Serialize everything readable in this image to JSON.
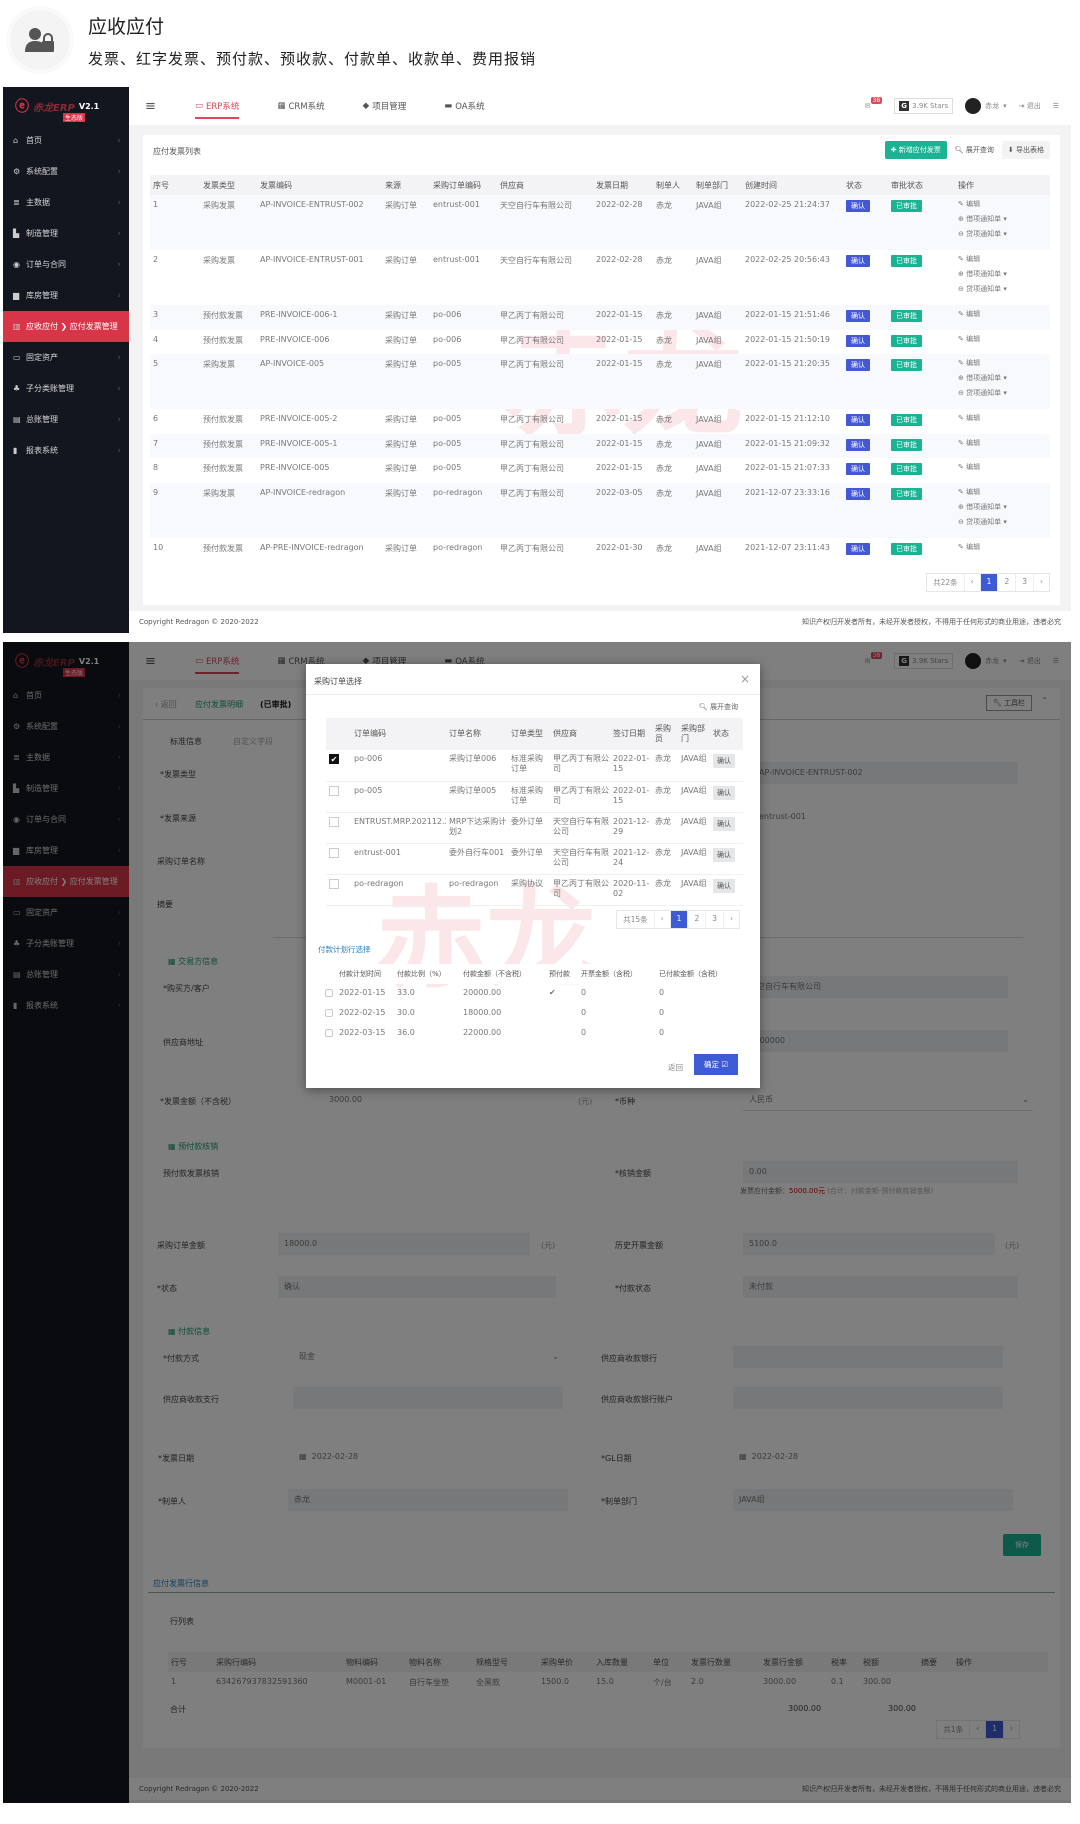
{
  "header": {
    "title": "应收应付",
    "subtitle": "发票、红字发票、预付款、预收款、付款单、收款单、费用报销",
    "icon": "user-lock-icon"
  },
  "app": {
    "logo": {
      "brand": "赤龙ERP",
      "version": "V2.1",
      "edition": "生态版"
    },
    "sidebar": [
      {
        "label": "首页",
        "icon": "home-icon"
      },
      {
        "label": "系统配置",
        "icon": "gear-icon"
      },
      {
        "label": "主数据",
        "icon": "database-icon"
      },
      {
        "label": "制造管理",
        "icon": "factory-icon"
      },
      {
        "label": "订单与合同",
        "icon": "eye-icon"
      },
      {
        "label": "库房管理",
        "icon": "warehouse-icon"
      },
      {
        "label": "应收应付 ❯ 应付发票管理",
        "icon": "bank-icon",
        "active": true
      },
      {
        "label": "固定资产",
        "icon": "monitor-icon"
      },
      {
        "label": "子分类账管理",
        "icon": "sitemap-icon"
      },
      {
        "label": "总账管理",
        "icon": "book-icon"
      },
      {
        "label": "报表系统",
        "icon": "chart-icon"
      }
    ],
    "tabs": [
      {
        "label": "ERP系统",
        "icon": "desktop-icon"
      },
      {
        "label": "CRM系统",
        "icon": "cards-icon"
      },
      {
        "label": "项目管理",
        "icon": "cube-icon"
      },
      {
        "label": "OA系统",
        "icon": "laptop-icon"
      }
    ],
    "topbar": {
      "badge": "38",
      "stars": "3.9K Stars",
      "user": "赤龙",
      "logout": "退出"
    },
    "footer": {
      "copyright": "Copyright Redragon © 2020-2022",
      "notice": "知识产权归开发者所有，未经开发者授权，不得用于任何形式的商业用途，违者必究"
    },
    "watermark": "赤龙"
  },
  "list": {
    "title": "应付发票列表",
    "add": "新增应付发票",
    "search": "展开查询",
    "export": "导出表格",
    "columns": [
      "序号",
      "发票类型",
      "发票编码",
      "来源",
      "采购订单编码",
      "供应商",
      "发票日期",
      "制单人",
      "制单部门",
      "创建时间",
      "状态",
      "审批状态",
      "操作"
    ],
    "rows": [
      {
        "c": [
          "1",
          "采购发票",
          "AP-INVOICE-ENTRUST-002",
          "采购订单",
          "entrust-001",
          "天空自行车有限公司",
          "2022-02-28",
          "赤龙",
          "JAVA组",
          "2022-02-25 21:24:37"
        ],
        "status": "确认",
        "approval": "已审批",
        "ops": [
          "编辑",
          "借项通知单",
          "贷项通知单"
        ]
      },
      {
        "c": [
          "2",
          "采购发票",
          "AP-INVOICE-ENTRUST-001",
          "采购订单",
          "entrust-001",
          "天空自行车有限公司",
          "2022-02-28",
          "赤龙",
          "JAVA组",
          "2022-02-25 20:56:43"
        ],
        "status": "确认",
        "approval": "已审批",
        "ops": [
          "编辑",
          "借项通知单",
          "贷项通知单"
        ]
      },
      {
        "c": [
          "3",
          "预付款发票",
          "PRE-INVOICE-006-1",
          "采购订单",
          "po-006",
          "甲乙丙丁有限公司",
          "2022-01-15",
          "赤龙",
          "JAVA组",
          "2022-01-15 21:51:46"
        ],
        "status": "确认",
        "approval": "已审批",
        "ops": [
          "编辑"
        ]
      },
      {
        "c": [
          "4",
          "预付款发票",
          "PRE-INVOICE-006",
          "采购订单",
          "po-006",
          "甲乙丙丁有限公司",
          "2022-01-15",
          "赤龙",
          "JAVA组",
          "2022-01-15 21:50:19"
        ],
        "status": "确认",
        "approval": "已审批",
        "ops": [
          "编辑"
        ]
      },
      {
        "c": [
          "5",
          "采购发票",
          "AP-INVOICE-005",
          "采购订单",
          "po-005",
          "甲乙丙丁有限公司",
          "2022-01-15",
          "赤龙",
          "JAVA组",
          "2022-01-15 21:20:35"
        ],
        "status": "确认",
        "approval": "已审批",
        "ops": [
          "编辑",
          "借项通知单",
          "贷项通知单"
        ]
      },
      {
        "c": [
          "6",
          "预付款发票",
          "PRE-INVOICE-005-2",
          "采购订单",
          "po-005",
          "甲乙丙丁有限公司",
          "2022-01-15",
          "赤龙",
          "JAVA组",
          "2022-01-15 21:12:10"
        ],
        "status": "确认",
        "approval": "已审批",
        "ops": [
          "编辑"
        ]
      },
      {
        "c": [
          "7",
          "预付款发票",
          "PRE-INVOICE-005-1",
          "采购订单",
          "po-005",
          "甲乙丙丁有限公司",
          "2022-01-15",
          "赤龙",
          "JAVA组",
          "2022-01-15 21:09:32"
        ],
        "status": "确认",
        "approval": "已审批",
        "ops": [
          "编辑"
        ]
      },
      {
        "c": [
          "8",
          "预付款发票",
          "PRE-INVOICE-005",
          "采购订单",
          "po-005",
          "甲乙丙丁有限公司",
          "2022-01-15",
          "赤龙",
          "JAVA组",
          "2022-01-15 21:07:33"
        ],
        "status": "确认",
        "approval": "已审批",
        "ops": [
          "编辑"
        ]
      },
      {
        "c": [
          "9",
          "采购发票",
          "AP-INVOICE-redragon",
          "采购订单",
          "po-redragon",
          "甲乙丙丁有限公司",
          "2022-03-05",
          "赤龙",
          "JAVA组",
          "2021-12-07 23:33:16"
        ],
        "status": "确认",
        "approval": "已审批",
        "ops": [
          "编辑",
          "借项通知单",
          "贷项通知单"
        ]
      },
      {
        "c": [
          "10",
          "预付款发票",
          "AP-PRE-INVOICE-redragon",
          "采购订单",
          "po-redragon",
          "甲乙丙丁有限公司",
          "2022-01-30",
          "赤龙",
          "JAVA组",
          "2021-12-07 23:11:43"
        ],
        "status": "确认",
        "approval": "已审批",
        "ops": [
          "编辑"
        ]
      }
    ],
    "pagination": {
      "total": "共22条",
      "prev": "‹",
      "pages": [
        "1",
        "2",
        "3"
      ],
      "next": "›"
    }
  },
  "detail": {
    "back": "‹ 返回",
    "title": "应付发票明细",
    "state": "(已审批)",
    "toolbar": "工具栏",
    "tabs": [
      "标准信息",
      "自定义字段"
    ],
    "left_labels": [
      {
        "l": "*发票类型"
      },
      {
        "l": "*发票来源"
      },
      {
        "l": "采购订单名称"
      },
      {
        "l": "摘要"
      }
    ],
    "right_values": [
      "AP-INVOICE-ENTRUST-002",
      "entrust-001"
    ],
    "sections": [
      "交易方信息",
      "预付款核销",
      "付款信息"
    ],
    "buyer_label": "*购买方/客户",
    "buyer_value": "天空自行车有限公司",
    "addr_label": "供应商地址",
    "addr_value": "V100000",
    "amount_label": "*发票金额（不含税）",
    "amount_value": "3000.00",
    "unit": "(元)",
    "currency_label": "*币种",
    "currency_value": "人民币",
    "prepay_label": "预付款发票核销",
    "writeoff_label": "*核销金额",
    "writeoff_value": "0.00",
    "hint_prefix": "发票应付金额：",
    "hint_amount": "5000.00元",
    "hint_suffix": "(合计：付款金额-预付款核销金额)",
    "po_amount_label": "采购订单金额",
    "po_amount_value": "18000.0",
    "hist_label": "历史开票金额",
    "hist_value": "5100.0",
    "status_label": "*状态",
    "status_value": "确认",
    "paystatus_label": "*付款状态",
    "paystatus_value": "未付款",
    "paymethod_label": "*付款方式",
    "paymethod_value": "现金",
    "bank_label": "供应商收款银行",
    "branch_label": "供应商收款支行",
    "account_label": "供应商收款银行账户",
    "invdate_label": "*发票日期",
    "invdate_value": "2022-02-28",
    "gldate_label": "*GL日期",
    "gldate_value": "2022-02-28",
    "creator_label": "*制单人",
    "creator_value": "赤龙",
    "dept_label": "*制单部门",
    "dept_value": "JAVA组",
    "save": "保存",
    "lines_link": "应付发票行信息",
    "lines_title": "行列表",
    "line_columns": [
      "行号",
      "采购行编码",
      "物料编码",
      "物料名称",
      "规格型号",
      "采购单价",
      "入库数量",
      "单位",
      "发票行数量",
      "发票行金额",
      "税率",
      "税额",
      "摘要",
      "操作"
    ],
    "line_rows": [
      [
        "1",
        "634267937832591360",
        "M0001-01",
        "自行车坐垫",
        "全黑款",
        "1500.0",
        "15.0",
        "个/台",
        "2.0",
        "3000.00",
        "0.1",
        "300.00",
        "",
        ""
      ]
    ],
    "total_label": "合计",
    "total_amount": "3000.00",
    "total_tax": "300.00",
    "pagination": {
      "total": "共1条",
      "prev": "‹",
      "pages": [
        "1"
      ],
      "next": "›"
    }
  },
  "modal": {
    "title": "采购订单选择",
    "close": "×",
    "search": "展开查询",
    "columns": [
      "",
      "订单编码",
      "订单名称",
      "订单类型",
      "供应商",
      "签订日期",
      "采购员",
      "采购部门",
      "状态"
    ],
    "rows": [
      {
        "checked": true,
        "c": [
          "po-006",
          "采购订单006",
          "标准采购订单",
          "甲乙丙丁有限公司",
          "2022-01-15",
          "赤龙",
          "JAVA组"
        ],
        "status": "确认"
      },
      {
        "checked": false,
        "c": [
          "po-005",
          "采购订单005",
          "标准采购订单",
          "甲乙丙丁有限公司",
          "2022-01-15",
          "赤龙",
          "JAVA组"
        ],
        "status": "确认"
      },
      {
        "checked": false,
        "c": [
          "ENTRUST.MRP.202112.2",
          "MRP下达采购计划2",
          "委外订单",
          "天空自行车有限公司",
          "2021-12-29",
          "赤龙",
          "JAVA组"
        ],
        "status": "确认"
      },
      {
        "checked": false,
        "c": [
          "entrust-001",
          "委外自行车001",
          "委外订单",
          "天空自行车有限公司",
          "2021-12-24",
          "赤龙",
          "JAVA组"
        ],
        "status": "确认"
      },
      {
        "checked": false,
        "c": [
          "po-redragon",
          "po-redragon",
          "采购协议",
          "甲乙丙丁有限公司",
          "2020-11-02",
          "赤龙",
          "JAVA组"
        ],
        "status": "确认"
      }
    ],
    "pagination": {
      "total": "共15条",
      "prev": "‹",
      "pages": [
        "1",
        "2",
        "3"
      ],
      "next": "›"
    },
    "plan_title": "付款计划行选择",
    "plan_columns": [
      "",
      "付款计划时间",
      "付款比例（%）",
      "付款金额（不含税）",
      "预付款",
      "开票金额（含税）",
      "已付款金额（含税）"
    ],
    "plan_rows": [
      {
        "c": [
          "2022-01-15",
          "33.0",
          "20000.00",
          "✔",
          "0",
          "0"
        ]
      },
      {
        "c": [
          "2022-02-15",
          "30.0",
          "18000.00",
          "",
          "0",
          "0"
        ]
      },
      {
        "c": [
          "2022-03-15",
          "36.0",
          "22000.00",
          "",
          "0",
          "0"
        ]
      }
    ],
    "back": "返回",
    "confirm": "确定 ☑"
  }
}
